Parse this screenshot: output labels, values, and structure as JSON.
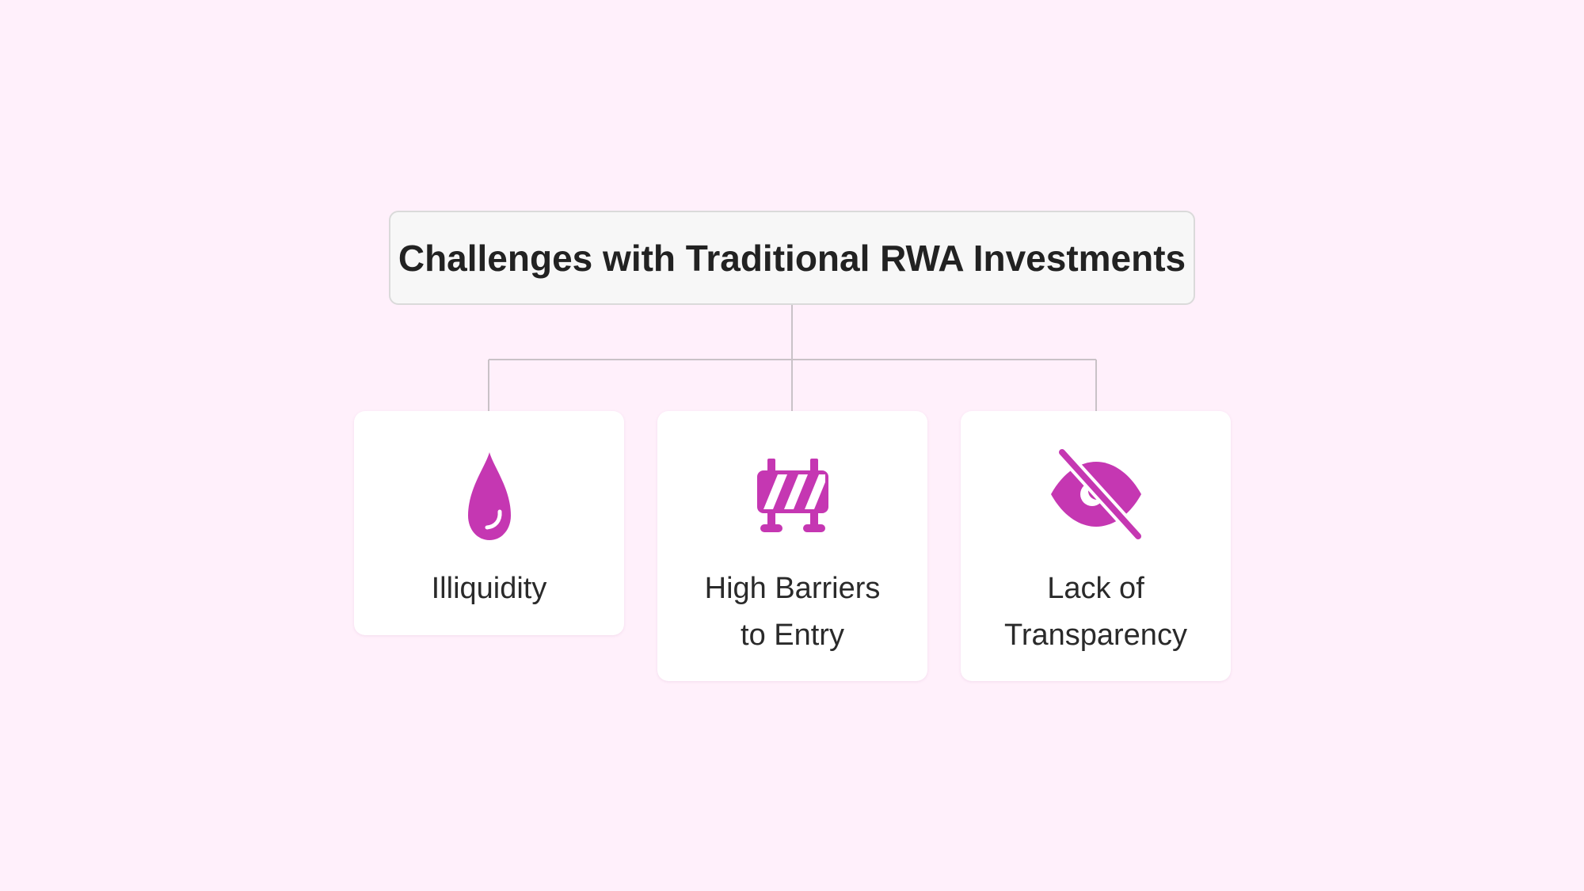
{
  "diagram": {
    "title": "Challenges with Traditional RWA Investments",
    "accent_color": "#c537b2",
    "connector_color": "#c9c2c7",
    "cards": [
      {
        "icon": "water-drop-icon",
        "lines": [
          "Illiquidity"
        ]
      },
      {
        "icon": "road-barrier-icon",
        "lines": [
          "High Barriers",
          "to Entry"
        ]
      },
      {
        "icon": "eye-slash-icon",
        "lines": [
          "Lack of",
          "Transparency"
        ]
      }
    ]
  }
}
